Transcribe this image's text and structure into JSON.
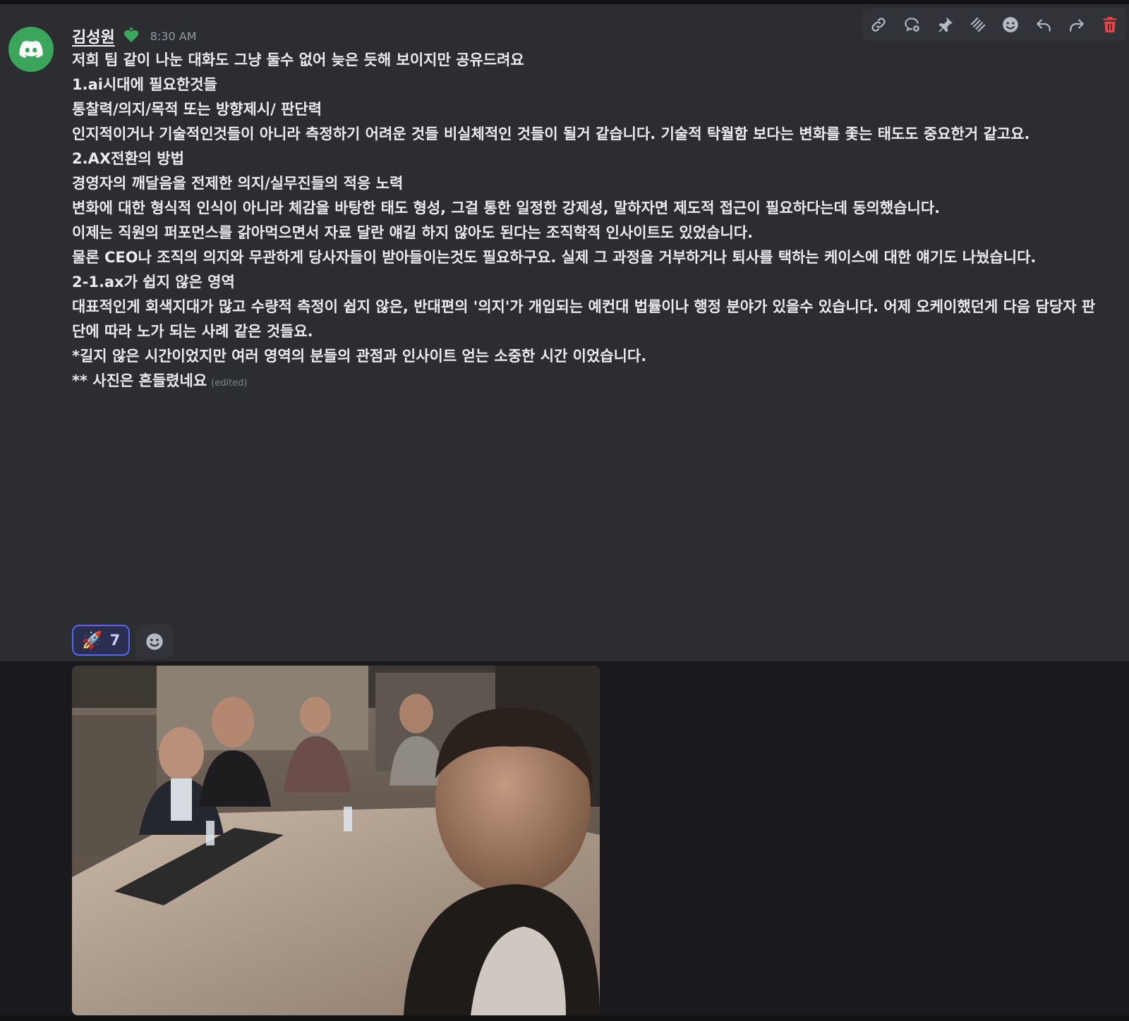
{
  "message": {
    "username": "김성원",
    "badge_icon": "heart-badge-icon",
    "timestamp": "8:30 AM",
    "avatar_icon": "discord-logo-icon",
    "lines": [
      "저희 팀 같이 나눈 대화도 그냥 둘수 없어 늦은 듯해 보이지만 공유드려요",
      "",
      "1.ai시대에 필요한것들",
      "통찰력/의지/목적 또는 방향제시/ 판단력",
      "",
      "인지적이거나 기술적인것들이 아니라 측정하기 어려운 것들 비실체적인 것들이 될거 같습니다. 기술적 탁월함 보다는 변화를 좇는 태도도 중요한거 같고요.",
      "",
      "2.AX전환의 방법",
      "",
      "경영자의 깨달음을 전제한 의지/실무진들의 적응 노력",
      "",
      "변화에 대한 형식적 인식이 아니라 체감을 바탕한 태도 형성, 그걸 통한 일정한 강제성, 말하자면 제도적 접근이 필요하다는데 동의했습니다.",
      "이제는 직원의 퍼포먼스를 갉아먹으면서 자료 달란 얘길 하지 않아도 된다는 조직학적 인사이트도 있었습니다.",
      "물론 CEO나 조직의 의지와 무관하게 당사자들이 받아들이는것도 필요하구요. 실제 그 과정을 거부하거나 퇴사를 택하는 케이스에 대한 얘기도 나눴습니다.",
      "",
      "2-1.ax가 쉽지 않은 영역",
      "대표적인게 회색지대가 많고 수량적 측정이 쉽지 않은, 반대편의 '의지'가 개입되는 예컨대 법률이나 행정 분야가 있을수 있습니다. 어제 오케이했던게 다음 담당자 판단에 따라 노가 되는 사례 같은 것들요.",
      "",
      "*길지 않은 시간이었지만 여러 영역의 분들의 관점과 인사이트 얻는 소중한 시간 이었습니다."
    ],
    "last_line": "** 사진은 흔들렸네요",
    "edited_label": "(edited)"
  },
  "toolbar": {
    "buttons": [
      {
        "icon": "link-icon"
      },
      {
        "icon": "thread-icon"
      },
      {
        "icon": "pin-icon"
      },
      {
        "icon": "mark-unread-icon"
      },
      {
        "icon": "add-reaction-icon"
      },
      {
        "icon": "reply-icon"
      },
      {
        "icon": "forward-icon"
      },
      {
        "icon": "trash-icon"
      }
    ]
  },
  "reactions": [
    {
      "emoji": "🚀",
      "count": "7"
    }
  ],
  "attachment": {
    "type": "photo",
    "icon": "group-selfie-photo"
  },
  "colors": {
    "accent": "#5865f2",
    "avatar_bg": "#3ba55c",
    "badge": "#3ba55c",
    "delete": "#ed4245"
  }
}
